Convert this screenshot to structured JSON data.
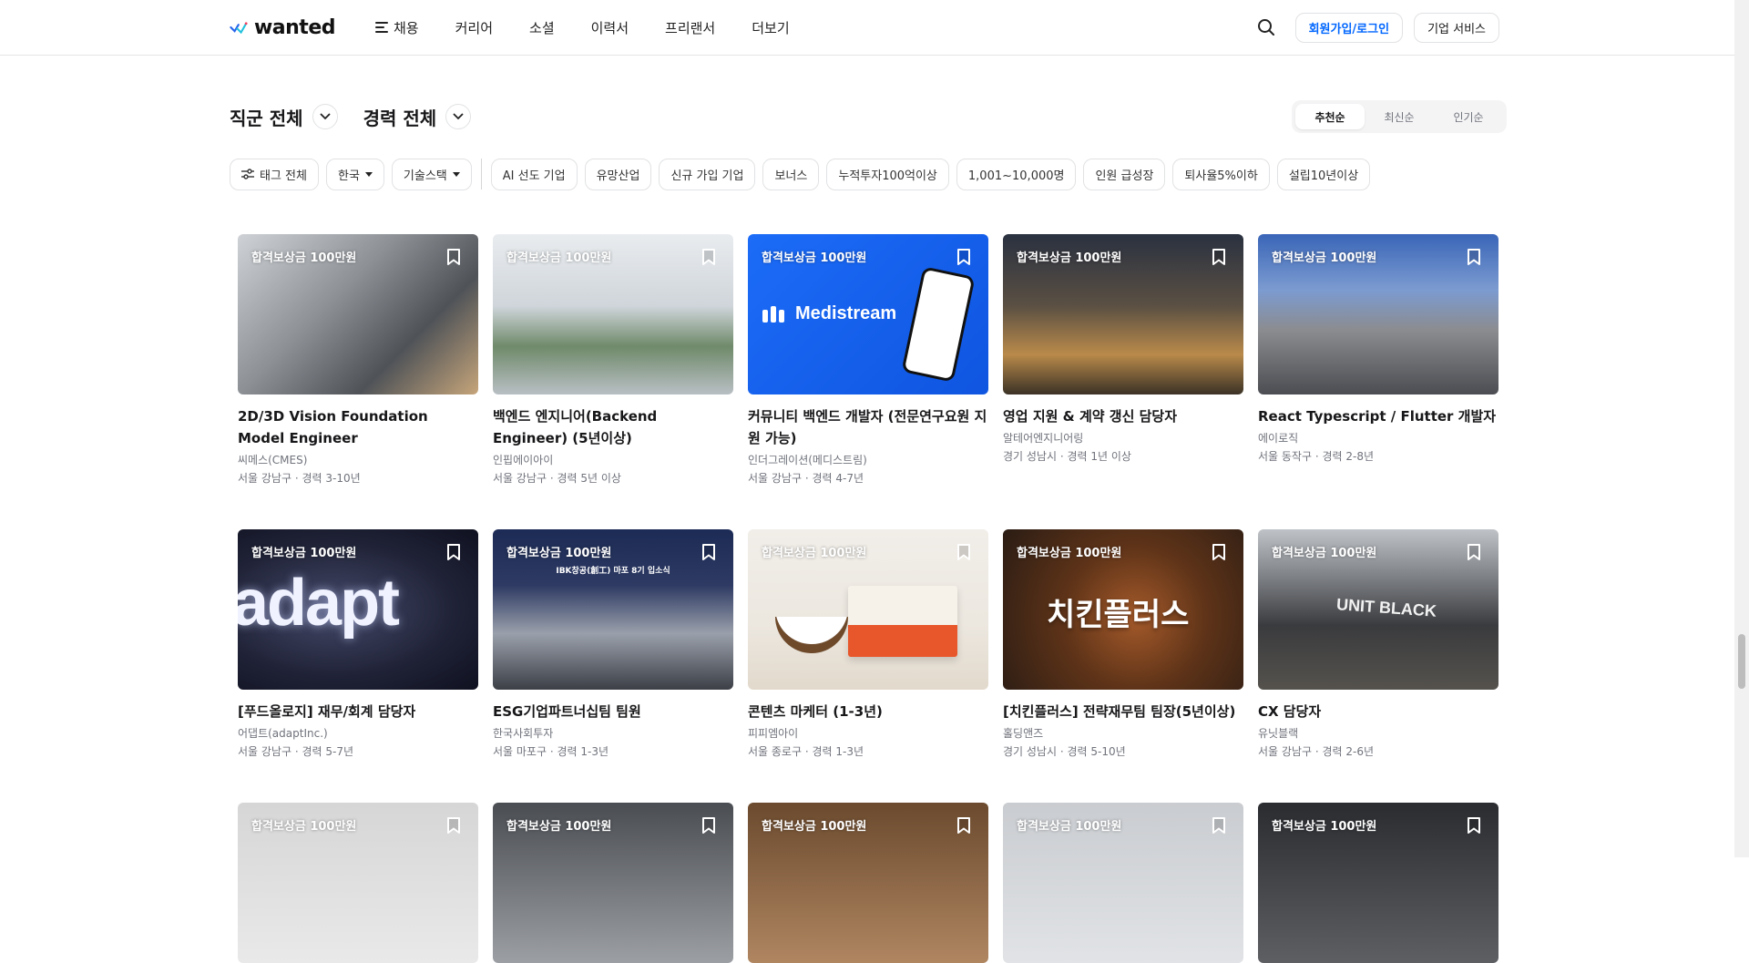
{
  "header": {
    "logo": "wanted",
    "nav": [
      "채용",
      "커리어",
      "소셜",
      "이력서",
      "프리랜서",
      "더보기"
    ],
    "login": "회원가입/로그인",
    "biz": "기업 서비스"
  },
  "filters": {
    "job": "직군 전체",
    "career": "경력 전체",
    "sort": [
      "추천순",
      "최신순",
      "인기순"
    ]
  },
  "tags": [
    "태그 전체",
    "한국",
    "기술스택",
    "AI 선도 기업",
    "유망산업",
    "신규 가입 기업",
    "보너스",
    "누적투자100억이상",
    "1,001~10,000명",
    "인원 급성장",
    "퇴사율5%이하",
    "설립10년이상"
  ],
  "reward_label": "합격보상금 100만원",
  "jobs": [
    {
      "title": "2D/3D Vision Foundation Model Engineer",
      "company": "씨메스(CMES)",
      "meta": "서울 강남구 · 경력 3-10년",
      "thumb": "robot-lab"
    },
    {
      "title": "백엔드 엔지니어(Backend Engineer) (5년이상)",
      "company": "인핍에이아이",
      "meta": "서울 강남구 · 경력 5년 이상",
      "thumb": "office"
    },
    {
      "title": "커뮤니티 백엔드 개발자 (전문연구요원 지원 가능)",
      "company": "인더그레이션(메디스트림)",
      "meta": "서울 강남구 · 경력 4-7년",
      "thumb": "medistream",
      "brand": "Medistream"
    },
    {
      "title": "영업 지원 & 계약 갱신 담당자",
      "company": "알테어엔지니어링",
      "meta": "경기 성남시 · 경력 1년 이상",
      "thumb": "lounge"
    },
    {
      "title": "React Typescript / Flutter 개발자",
      "company": "에이로직",
      "meta": "서울 동작구 · 경력 2-8년",
      "thumb": "building"
    },
    {
      "title": "[푸드올로지] 재무/회계 담당자",
      "company": "어댑트(adaptInc.)",
      "meta": "서울 강남구 · 경력 5-7년",
      "thumb": "adapt",
      "brand": "adapt"
    },
    {
      "title": "ESG기업파트너십팀 팀원",
      "company": "한국사회투자",
      "meta": "서울 마포구 · 경력 1-3년",
      "thumb": "group",
      "brand": "IBK창공(創工) 마포 8기 입소식"
    },
    {
      "title": "콘텐츠 마케터 (1-3년)",
      "company": "피피엠아이",
      "meta": "서울 종로구 · 경력 1-3년",
      "thumb": "product"
    },
    {
      "title": "[치킨플러스] 전략재무팀 팀장(5년이상)",
      "company": "홀딩앤즈",
      "meta": "경기 성남시 · 경력 5-10년",
      "thumb": "chicken",
      "brand": "치킨플러스"
    },
    {
      "title": "CX 담당자",
      "company": "유닛블랙",
      "meta": "서울 강남구 · 경력 2-6년",
      "thumb": "store",
      "brand": "UNIT BLACK"
    },
    {
      "title": "",
      "company": "",
      "meta": "",
      "thumb": "partial1"
    },
    {
      "title": "",
      "company": "",
      "meta": "",
      "thumb": "partial2"
    },
    {
      "title": "",
      "company": "",
      "meta": "",
      "thumb": "partial3"
    },
    {
      "title": "",
      "company": "",
      "meta": "",
      "thumb": "partial4"
    },
    {
      "title": "",
      "company": "",
      "meta": "",
      "thumb": "partial5"
    }
  ],
  "colors": {
    "accent": "#0066ff",
    "medistream": "#1565f5"
  }
}
